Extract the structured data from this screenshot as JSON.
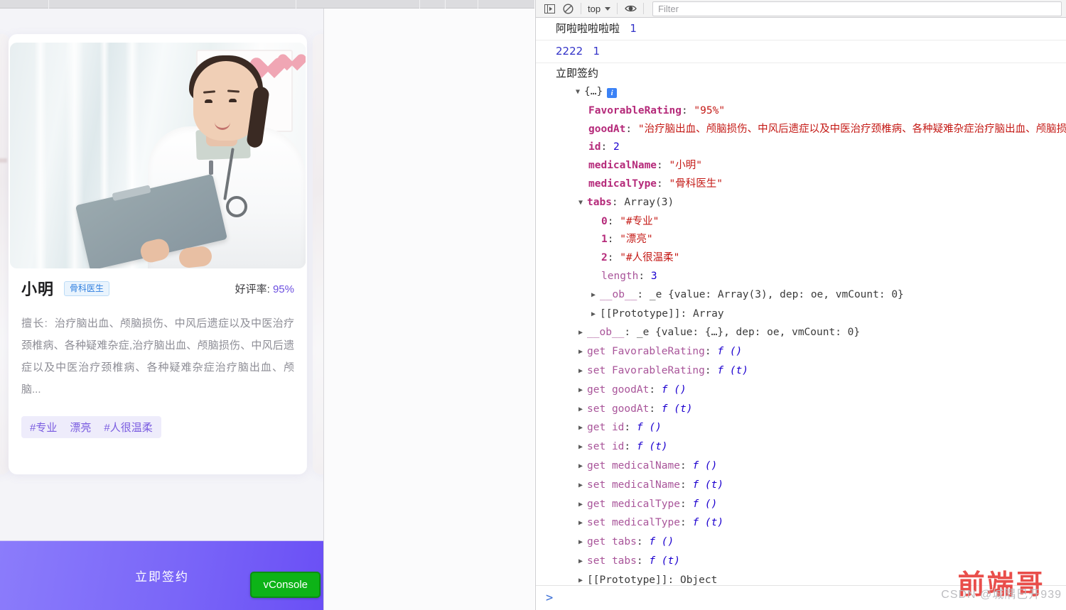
{
  "mobile": {
    "doctor_card": {
      "name": "小明",
      "type_badge": "骨科医生",
      "rating_label": "好评率:",
      "rating_value": "95%",
      "goodat_label": "擅长:",
      "goodat_text": "治疗脑出血、颅脑损伤、中风后遗症以及中医治疗颈椎病、各种疑难杂症,治疗脑出血、颅脑损伤、中风后遗症以及中医治疗颈椎病、各种疑难杂症治疗脑出血、颅脑...",
      "tags": [
        "#专业",
        "漂亮",
        "#人很温柔"
      ]
    },
    "cta_label": "立即签约",
    "vconsole_label": "vConsole"
  },
  "devtools": {
    "toolbar": {
      "sidebar_toggle_icon": "sidebar-icon",
      "clear_icon": "clear-console-icon",
      "context_label": "top",
      "eye_icon": "eye-icon",
      "filter_placeholder": "Filter"
    },
    "logs": [
      {
        "text": "阿啦啦啦啦啦",
        "count": "1"
      },
      {
        "text": "2222",
        "count": "1"
      }
    ],
    "object_log": {
      "header": "立即签约",
      "collapsed_preview": "{…}",
      "info_badge": "i",
      "properties": [
        {
          "key": "FavorableRating",
          "value": "\"95%\"",
          "kind": "string"
        },
        {
          "key": "goodAt",
          "value": "\"治疗脑出血、颅脑损伤、中风后遗症以及中医治疗颈椎病、各种疑难杂症治疗脑出血、颅脑损伤、中风后遗症以及中医治疗颈椎病\"",
          "kind": "string"
        },
        {
          "key": "id",
          "value": "2",
          "kind": "number"
        },
        {
          "key": "medicalName",
          "value": "\"小明\"",
          "kind": "string"
        },
        {
          "key": "medicalType",
          "value": "\"骨科医生\"",
          "kind": "string"
        }
      ],
      "tabs_key": "tabs",
      "tabs_type": "Array(3)",
      "tabs_items": [
        {
          "index": "0",
          "value": "\"#专业\""
        },
        {
          "index": "1",
          "value": "\"漂亮\""
        },
        {
          "index": "2",
          "value": "\"#人很温柔\""
        }
      ],
      "tabs_length_key": "length",
      "tabs_length_value": "3",
      "tabs_ob_key": "__ob__",
      "tabs_ob_value": "_e {value: Array(3), dep: oe, vmCount: 0}",
      "tabs_proto_key": "[[Prototype]]",
      "tabs_proto_value": "Array",
      "root_ob_key": "__ob__",
      "root_ob_value": "_e {value: {…}, dep: oe, vmCount: 0}",
      "accessors": [
        {
          "kind": "get",
          "name": "FavorableRating",
          "sig": "f ()"
        },
        {
          "kind": "set",
          "name": "FavorableRating",
          "sig": "f (t)"
        },
        {
          "kind": "get",
          "name": "goodAt",
          "sig": "f ()"
        },
        {
          "kind": "set",
          "name": "goodAt",
          "sig": "f (t)"
        },
        {
          "kind": "get",
          "name": "id",
          "sig": "f ()"
        },
        {
          "kind": "set",
          "name": "id",
          "sig": "f (t)"
        },
        {
          "kind": "get",
          "name": "medicalName",
          "sig": "f ()"
        },
        {
          "kind": "set",
          "name": "medicalName",
          "sig": "f (t)"
        },
        {
          "kind": "get",
          "name": "medicalType",
          "sig": "f ()"
        },
        {
          "kind": "set",
          "name": "medicalType",
          "sig": "f (t)"
        },
        {
          "kind": "get",
          "name": "tabs",
          "sig": "f ()"
        },
        {
          "kind": "set",
          "name": "tabs",
          "sig": "f (t)"
        }
      ],
      "root_proto_key": "[[Prototype]]",
      "root_proto_value": "Object"
    },
    "prompt_symbol": ">"
  },
  "watermark": {
    "title": "前端哥",
    "subtitle": "CSDN @城隅巳开939"
  },
  "colors": {
    "accent_purple": "#6a4ff5",
    "badge_blue": "#2f7fe0",
    "vconsole_green": "#0db317",
    "watermark_red": "#e8403c"
  }
}
